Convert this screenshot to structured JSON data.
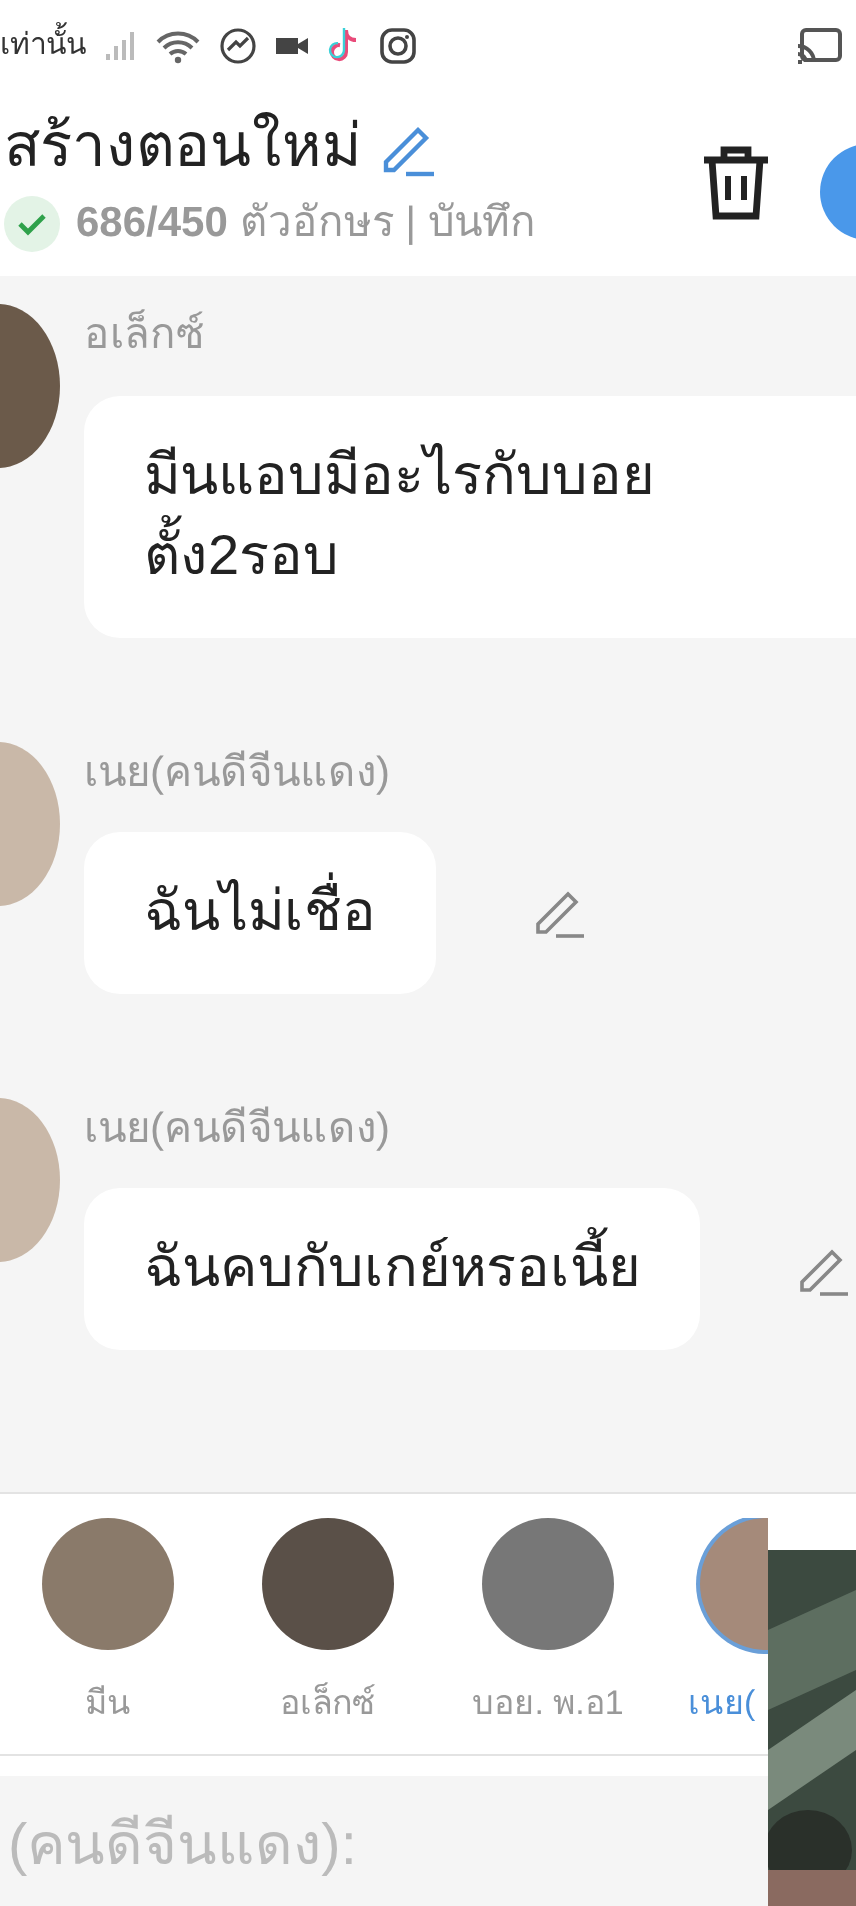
{
  "status_bar": {
    "carrier": "เท่านั้น"
  },
  "header": {
    "title": "สร้างตอนใหม่",
    "saved": true,
    "count": "686/450",
    "count_unit": "ตัวอักษร | บันทึก"
  },
  "messages": [
    {
      "sender": "อเล็กซ์",
      "text": "มีนแอบมีอะไรกับบอย\nตั้ง2รอบ",
      "editable": false
    },
    {
      "sender": "เนย(คนดีจีนแดง)",
      "text": "ฉันไม่เชื่อ",
      "editable": true
    },
    {
      "sender": "เนย(คนดีจีนแดง)",
      "text": "ฉันคบกับเกย์หรอเนี้ย",
      "editable": true
    }
  ],
  "characters": [
    {
      "name": "มีน",
      "selected": false
    },
    {
      "name": "อเล็กซ์",
      "selected": false
    },
    {
      "name": "บอย. พ.อ1",
      "selected": false
    },
    {
      "name": "เนย(",
      "selected": true
    }
  ],
  "composer": {
    "placeholder": "(คนดีจีนแดง):"
  }
}
